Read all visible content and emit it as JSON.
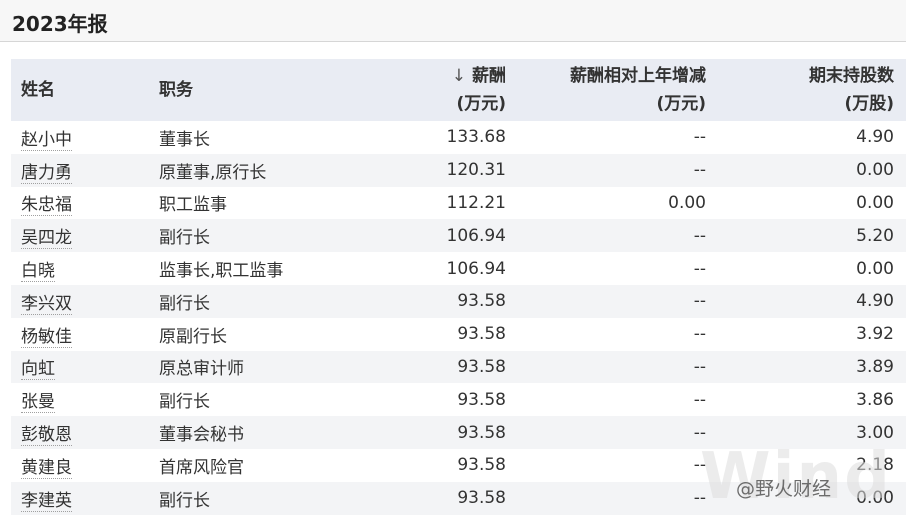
{
  "report_title": "2023年报",
  "table": {
    "headers": {
      "name": "姓名",
      "position": "职务",
      "salary_line1": "薪酬",
      "salary_line2": "(万元)",
      "change_line1": "薪酬相对上年增减",
      "change_line2": "(万元)",
      "shares_line1": "期末持股数",
      "shares_line2": "(万股)"
    },
    "sort_icon": "sort-descending-icon",
    "sort_glyph": "↓",
    "rows": [
      {
        "name": "赵小中",
        "position": "董事长",
        "salary": "133.68",
        "change": "--",
        "shares": "4.90"
      },
      {
        "name": "唐力勇",
        "position": "原董事,原行长",
        "salary": "120.31",
        "change": "--",
        "shares": "0.00"
      },
      {
        "name": "朱忠福",
        "position": "职工监事",
        "salary": "112.21",
        "change": "0.00",
        "shares": "0.00"
      },
      {
        "name": "吴四龙",
        "position": "副行长",
        "salary": "106.94",
        "change": "--",
        "shares": "5.20"
      },
      {
        "name": "白晓",
        "position": "监事长,职工监事",
        "salary": "106.94",
        "change": "--",
        "shares": "0.00"
      },
      {
        "name": "李兴双",
        "position": "副行长",
        "salary": "93.58",
        "change": "--",
        "shares": "4.90"
      },
      {
        "name": "杨敏佳",
        "position": "原副行长",
        "salary": "93.58",
        "change": "--",
        "shares": "3.92"
      },
      {
        "name": "向虹",
        "position": "原总审计师",
        "salary": "93.58",
        "change": "--",
        "shares": "3.89"
      },
      {
        "name": "张曼",
        "position": "副行长",
        "salary": "93.58",
        "change": "--",
        "shares": "3.86"
      },
      {
        "name": "彭敬恩",
        "position": "董事会秘书",
        "salary": "93.58",
        "change": "--",
        "shares": "3.00"
      },
      {
        "name": "黄建良",
        "position": "首席风险官",
        "salary": "93.58",
        "change": "--",
        "shares": "2.18"
      },
      {
        "name": "李建英",
        "position": "副行长",
        "salary": "93.58",
        "change": "--",
        "shares": "0.00"
      }
    ]
  },
  "watermark": {
    "brand": "Wind",
    "account": "@野火财经"
  }
}
